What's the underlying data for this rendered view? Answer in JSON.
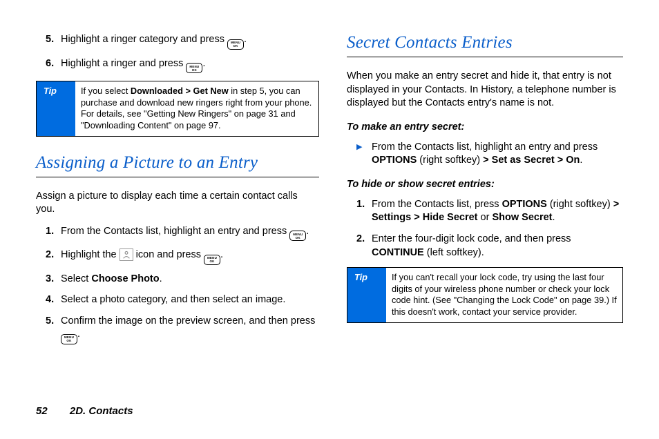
{
  "left": {
    "step5_a": "Highlight a ringer category and press ",
    "step5_b": ".",
    "step6_a": "Highlight a ringer and press ",
    "step6_b": ".",
    "tip_label": "Tip",
    "tip_a": "If you select ",
    "tip_b": "Downloaded > Get New",
    "tip_c": " in step 5, you can purchase and download new ringers right from your phone. For details, see \"Getting New Ringers\" on page 31 and \"Downloading Content\" on page 97.",
    "h2": "Assigning a Picture to an Entry",
    "intro": "Assign a picture to display each time a certain contact calls you.",
    "s1_a": "From the Contacts list, highlight an entry and press ",
    "s1_b": ".",
    "s2_a": "Highlight the ",
    "s2_b": " icon and press ",
    "s2_c": ".",
    "s3_a": "Select ",
    "s3_b": "Choose Photo",
    "s3_c": ".",
    "s4": "Select a photo category, and then select an image.",
    "s5_a": "Confirm the image on the preview screen, and then press ",
    "s5_b": "."
  },
  "right": {
    "h2": "Secret Contacts Entries",
    "intro": "When you make an entry secret and hide it, that entry is not displayed in your Contacts. In History, a telephone number is displayed but the Contacts entry's name is not.",
    "sub1": "To make an entry secret:",
    "b1_a": "From the Contacts list, highlight an entry and press ",
    "b1_b": "OPTIONS",
    "b1_c": " (right softkey) ",
    "b1_d": "> Set as Secret > On",
    "b1_e": ".",
    "sub2": "To hide or show secret entries:",
    "r1_a": "From the Contacts list, press ",
    "r1_b": "OPTIONS",
    "r1_c": " (right softkey) ",
    "r1_d": "> Settings > Hide Secret",
    "r1_e": " or ",
    "r1_f": "Show Secret",
    "r1_g": ".",
    "r2_a": "Enter the four-digit lock code, and then press ",
    "r2_b": "CONTINUE",
    "r2_c": " (left softkey).",
    "tip_label": "Tip",
    "tip": "If you can't recall your lock code, try using the last four digits of your wireless phone number or check your lock code hint. (See \"Changing the Lock Code\" on page 39.) If this doesn't work, contact your service provider."
  },
  "footer": {
    "page": "52",
    "section": "2D. Contacts"
  }
}
